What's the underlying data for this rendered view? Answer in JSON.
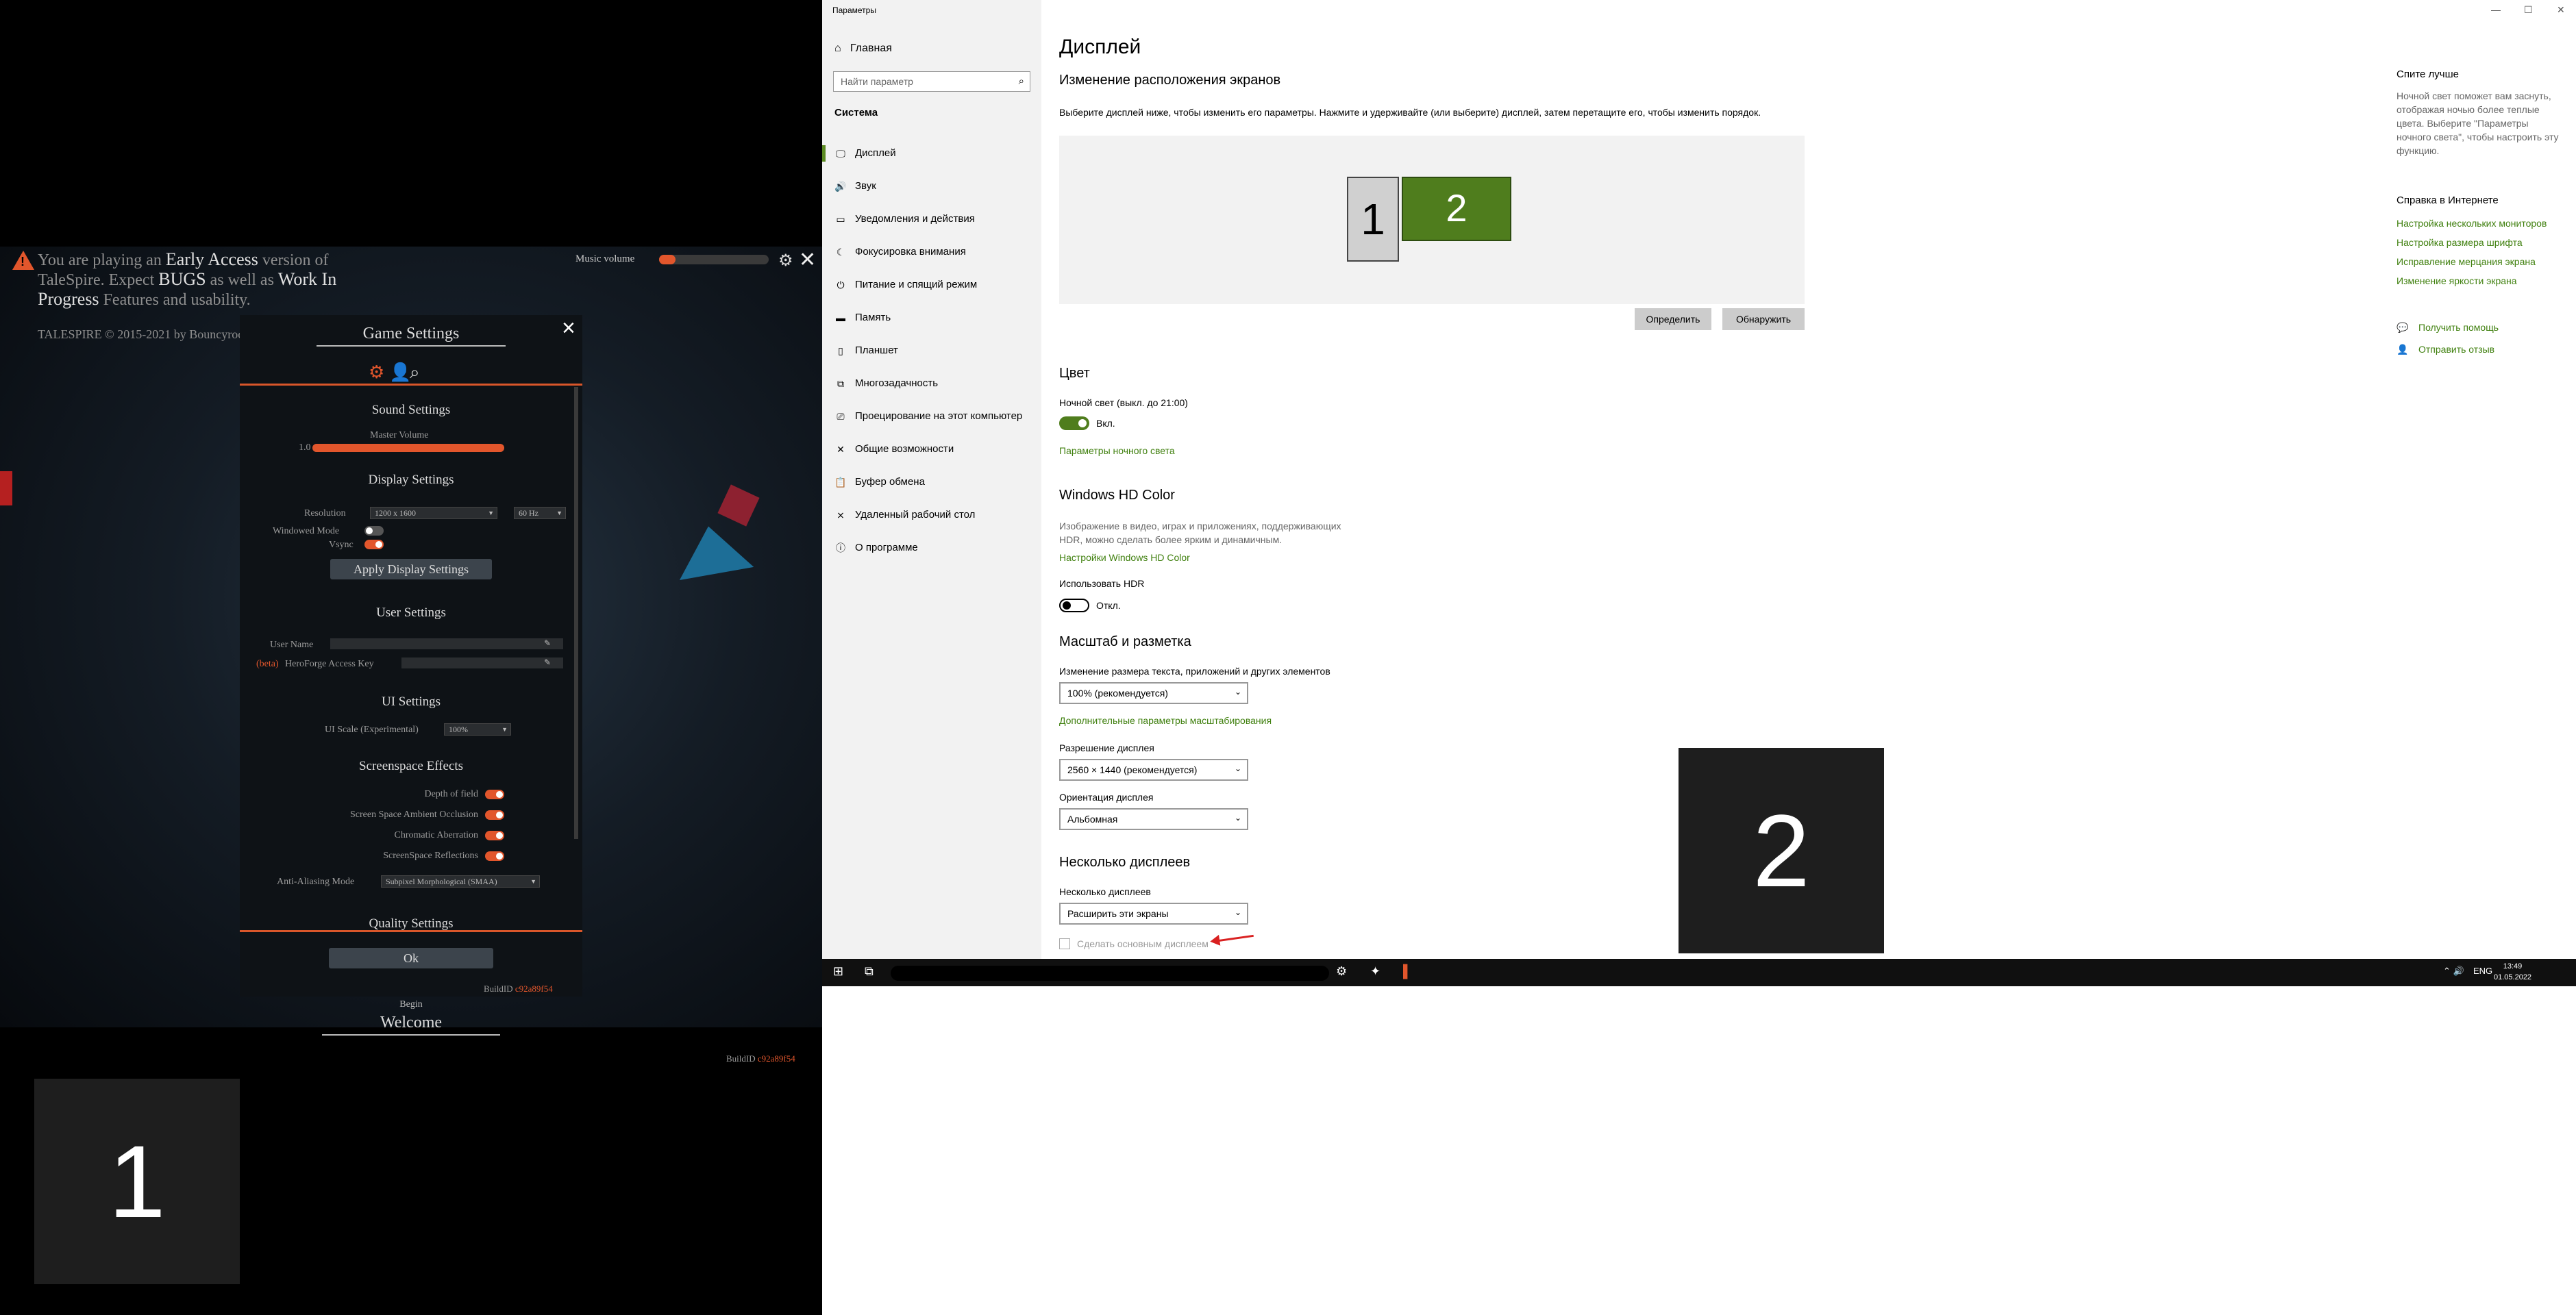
{
  "game": {
    "notice_line1": "You are playing an ",
    "notice_early": "Early Access",
    "notice_line2": " version of TaleSpire. Expect ",
    "notice_bugs": "BUGS",
    "notice_line3": " as well as ",
    "notice_wip": "Work In Progress",
    "notice_line4": " Features and usability.",
    "copyright": "TALESPIRE © 2015-2021 by Bouncyrock",
    "music_volume_label": "Music volume",
    "music_volume": 0.15,
    "panel": {
      "title": "Game Settings",
      "sound_title": "Sound Settings",
      "master_volume_label": "Master Volume",
      "master_volume_value": "1.0",
      "master_volume": 1.0,
      "display_title": "Display Settings",
      "resolution_label": "Resolution",
      "resolution_value": "1200 x 1600",
      "refresh_value": "60 Hz",
      "windowed_label": "Windowed Mode",
      "windowed_on": false,
      "vsync_label": "Vsync",
      "vsync_on": true,
      "apply_button": "Apply Display Settings",
      "user_title": "User Settings",
      "user_name_label": "User Name",
      "beta_tag": "(beta)",
      "heroforge_label": "HeroForge Access Key",
      "ui_title": "UI Settings",
      "ui_scale_label": "UI Scale (Experimental)",
      "ui_scale_value": "100%",
      "screenspace_title": "Screenspace Effects",
      "effects": [
        {
          "label": "Depth of field",
          "on": true
        },
        {
          "label": "Screen Space Ambient Occlusion",
          "on": true
        },
        {
          "label": "Chromatic Aberration",
          "on": true
        },
        {
          "label": "ScreenSpace Reflections",
          "on": true
        }
      ],
      "aa_label": "Anti-Aliasing Mode",
      "aa_value": "Subpixel Morphological (SMAA)",
      "quality_title": "Quality Settings",
      "ok_button": "Ok",
      "build_label": "BuildID",
      "build_id": "c92a89f54"
    },
    "begin": "Begin",
    "welcome": "Welcome",
    "build_label2": "BuildID",
    "build_id2": "c92a89f54",
    "identify_1": "1"
  },
  "settings": {
    "window_title": "Параметры",
    "home": "Главная",
    "search_placeholder": "Найти параметр",
    "category": "Система",
    "nav": [
      {
        "icon": "monitor-icon",
        "glyph": "🖵",
        "label": "Дисплей",
        "active": true
      },
      {
        "icon": "speaker-icon",
        "glyph": "🔊",
        "label": "Звук",
        "active": false
      },
      {
        "icon": "notifications-icon",
        "glyph": "▭",
        "label": "Уведомления и действия",
        "active": false
      },
      {
        "icon": "focus-icon",
        "glyph": "☾",
        "label": "Фокусировка внимания",
        "active": false
      },
      {
        "icon": "power-icon",
        "glyph": "⏻",
        "label": "Питание и спящий режим",
        "active": false
      },
      {
        "icon": "storage-icon",
        "glyph": "▬",
        "label": "Память",
        "active": false
      },
      {
        "icon": "tablet-icon",
        "glyph": "▯",
        "label": "Планшет",
        "active": false
      },
      {
        "icon": "multitasking-icon",
        "glyph": "⧉",
        "label": "Многозадачность",
        "active": false
      },
      {
        "icon": "projecting-icon",
        "glyph": "⎚",
        "label": "Проецирование на этот компьютер",
        "active": false
      },
      {
        "icon": "shared-experiences-icon",
        "glyph": "✕",
        "label": "Общие возможности",
        "active": false
      },
      {
        "icon": "clipboard-icon",
        "glyph": "📋",
        "label": "Буфер обмена",
        "active": false
      },
      {
        "icon": "remote-desktop-icon",
        "glyph": "⨯",
        "label": "Удаленный рабочий стол",
        "active": false
      },
      {
        "icon": "info-icon",
        "glyph": "ⓘ",
        "label": "О программе",
        "active": false
      }
    ],
    "page_title": "Дисплей",
    "arrangement_title": "Изменение расположения экранов",
    "arrangement_desc": "Выберите дисплей ниже, чтобы изменить его параметры. Нажмите и удерживайте (или выберите) дисплей, затем перетащите его, чтобы изменить порядок.",
    "monitor_1": "1",
    "monitor_2": "2",
    "identify_button": "Определить",
    "detect_button": "Обнаружить",
    "color_title": "Цвет",
    "night_light_label": "Ночной свет (выкл. до 21:00)",
    "night_light_state": "Вкл.",
    "night_light_link": "Параметры ночного света",
    "hd_color_title": "Windows HD Color",
    "hd_color_desc1": "Изображение в видео, играх и приложениях, поддерживающих",
    "hd_color_desc2": "HDR, можно сделать более ярким и динамичным.",
    "hd_color_link": "Настройки Windows HD Color",
    "hdr_label": "Использовать HDR",
    "hdr_state": "Откл.",
    "scale_title": "Масштаб и разметка",
    "scale_label": "Изменение размера текста, приложений и других элементов",
    "scale_value": "100% (рекомендуется)",
    "scale_link": "Дополнительные параметры масштабирования",
    "resolution_label": "Разрешение дисплея",
    "resolution_value": "2560 × 1440 (рекомендуется)",
    "orientation_label": "Ориентация дисплея",
    "orientation_value": "Альбомная",
    "multi_title": "Несколько дисплеев",
    "multi_label": "Несколько дисплеев",
    "multi_value": "Расширить эти экраны",
    "make_main_label": "Сделать основным дисплеем",
    "identify_2": "2",
    "right": {
      "night_title": "Спите лучше",
      "night_desc": "Ночной свет поможет вам заснуть, отображая ночью более теплые цвета. Выберите \"Параметры ночного света\", чтобы настроить эту функцию.",
      "help_title": "Справка в Интернете",
      "links": [
        "Настройка нескольких мониторов",
        "Настройка размера шрифта",
        "Исправление мерцания экрана",
        "Изменение яркости экрана"
      ],
      "get_help": "Получить помощь",
      "feedback": "Отправить отзыв"
    }
  },
  "taskbar": {
    "lang": "ENG",
    "time": "13:49",
    "date": "01.05.2022"
  }
}
